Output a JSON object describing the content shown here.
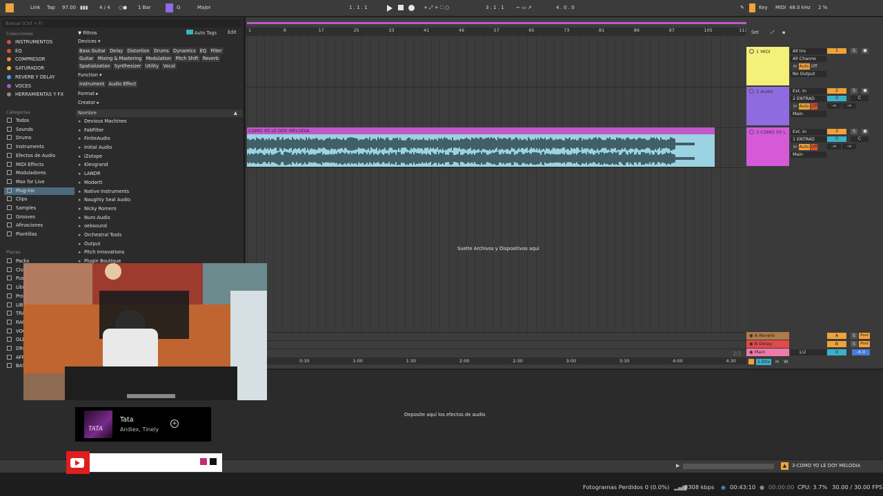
{
  "topbar": {
    "link": "Link",
    "tap": "Tap",
    "tempo": "97.00",
    "signature": "4 / 4",
    "quantize": "1 Bar",
    "scale_root": "G",
    "scale_mode": "Major",
    "arrangement_position": "1 .  1 .  1",
    "loop_start": "3 .  1 .  1",
    "loop_length": "4 .  0 .  0",
    "key_label": "Key",
    "midi_label": "MIDI",
    "sample_rate": "48.0 kHz",
    "cpu_load": "2 %"
  },
  "browser": {
    "search_placeholder": "Buscar (Ctrl + F)",
    "collections_title": "Colecciones",
    "collections": [
      {
        "label": "INSTRUMENTOS",
        "color": "#e04b4b"
      },
      {
        "label": "EQ",
        "color": "#e04b4b"
      },
      {
        "label": "COMPRESOR",
        "color": "#f0823b"
      },
      {
        "label": "SATURADOR",
        "color": "#f0b43b"
      },
      {
        "label": "REVERB Y DELAY",
        "color": "#4aa0e0"
      },
      {
        "label": "VOCES",
        "color": "#a05ad0"
      },
      {
        "label": "HERRAMIENTAS Y FX",
        "color": "#8a8a8a"
      }
    ],
    "categories_title": "Categorías",
    "categories": [
      "Todos",
      "Sounds",
      "Drums",
      "Instruments",
      "Efectos de Audio",
      "MIDI Effects",
      "Moduladores",
      "Max for Live",
      "Plug-ins",
      "Clips",
      "Samples",
      "Grooves",
      "Afinaciones",
      "Plantillas"
    ],
    "selected_category": "Plug-ins",
    "places_title": "Places",
    "places": [
      "Packs",
      "Clo",
      "Pus",
      "Libr",
      "Pro",
      "LIBI",
      "TRA",
      "RAC",
      "VOC",
      "OLD",
      "DRI",
      "AFR",
      "BAS"
    ],
    "filters_title": "Filtros",
    "auto_tags": "Auto Tags",
    "edit": "Edit",
    "devices_label": "Devices",
    "device_tags": [
      "Bass Guitar",
      "Delay",
      "Distortion",
      "Drums",
      "Dynamics",
      "EQ",
      "Filter",
      "Guitar",
      "Mixing & Mastering",
      "Modulation",
      "Pitch Shift",
      "Reverb",
      "Spatialization",
      "Synthesizer",
      "Utility",
      "Vocal"
    ],
    "function_label": "Function",
    "function_tags": [
      "Instrument",
      "Audio Effect"
    ],
    "format_label": "Format",
    "creator_label": "Creator",
    "name_header": "Nombre",
    "vendors": [
      "Devious Machines",
      "FabFilter",
      "FiniteAudio",
      "Initial Audio",
      "iZotope",
      "Klevgrand",
      "LANDR",
      "Modartt",
      "Native Instruments",
      "Naughty Seal Audio",
      "Nicky Romero",
      "Nuro Audio",
      "oeksound",
      "Orchestral Tools",
      "Output",
      "Pitch Innovations",
      "Plugin Boutique"
    ]
  },
  "arrangement": {
    "bar_ticks": [
      "1",
      "9",
      "17",
      "25",
      "33",
      "41",
      "49",
      "57",
      "65",
      "73",
      "81",
      "89",
      "97",
      "105",
      "113"
    ],
    "clip_name": "COMO YO LE DOY MELODIA",
    "drop_text": "Suelte Archivos y Dispositivos aquí",
    "time_ticks": [
      "0:30",
      "1:00",
      "1:30",
      "2:00",
      "2:30",
      "3:00",
      "3:30",
      "4:00",
      "4:30"
    ],
    "page_count": "2/1",
    "set_label": "Set"
  },
  "tracks": [
    {
      "name": "1 MIDI",
      "color": "#f4f07a",
      "input": "All Ins",
      "channel": "All Channe",
      "monitor": [
        "In",
        "Auto",
        "Off"
      ],
      "output": "No Output",
      "number": "1"
    },
    {
      "name": "2 Audio",
      "color": "#8f6be0",
      "input": "Ext. In",
      "channel": "2 ENTRAD",
      "monitor": [
        "In",
        "Auto",
        "Off"
      ],
      "output": "Main",
      "number": "2",
      "volume": "0",
      "pan": "C",
      "sends": "-∞"
    },
    {
      "name": "3 COMO YO L",
      "color": "#d65ad8",
      "input": "Ext. In",
      "channel": "1 ENTRAD",
      "monitor": [
        "In",
        "Auto",
        "Off"
      ],
      "output": "Main",
      "number": "3",
      "volume": "0",
      "pan": "C",
      "sends": "-∞"
    }
  ],
  "returns": [
    {
      "name": "A Reverb",
      "letter": "A",
      "color": "#b07a4a"
    },
    {
      "name": "B Delay",
      "letter": "B",
      "color": "#e04b4b"
    }
  ],
  "main_track": {
    "name": "Main",
    "routing": "1/2",
    "volume": "0",
    "level": "-6.0",
    "zoom": "1.00x",
    "h": "H",
    "w": "W"
  },
  "detail": {
    "fx_drop_text": "Deposite aquí los efectos de audio",
    "selected_track": "3-COMO YO LE DOY MELODIA"
  },
  "now_playing": {
    "title": "Tata",
    "artist": "Andiex, Tinely",
    "art_text": "TATA"
  },
  "obs_status": {
    "dropped_frames": "Fotogramas Perdidos 0 (0.0%)",
    "bitrate": "8308 kbps",
    "live_time": "00:43:10",
    "rec_time": "00:00:00",
    "cpu": "CPU: 3.7%",
    "fps": "30.00 / 30.00 FPS"
  }
}
